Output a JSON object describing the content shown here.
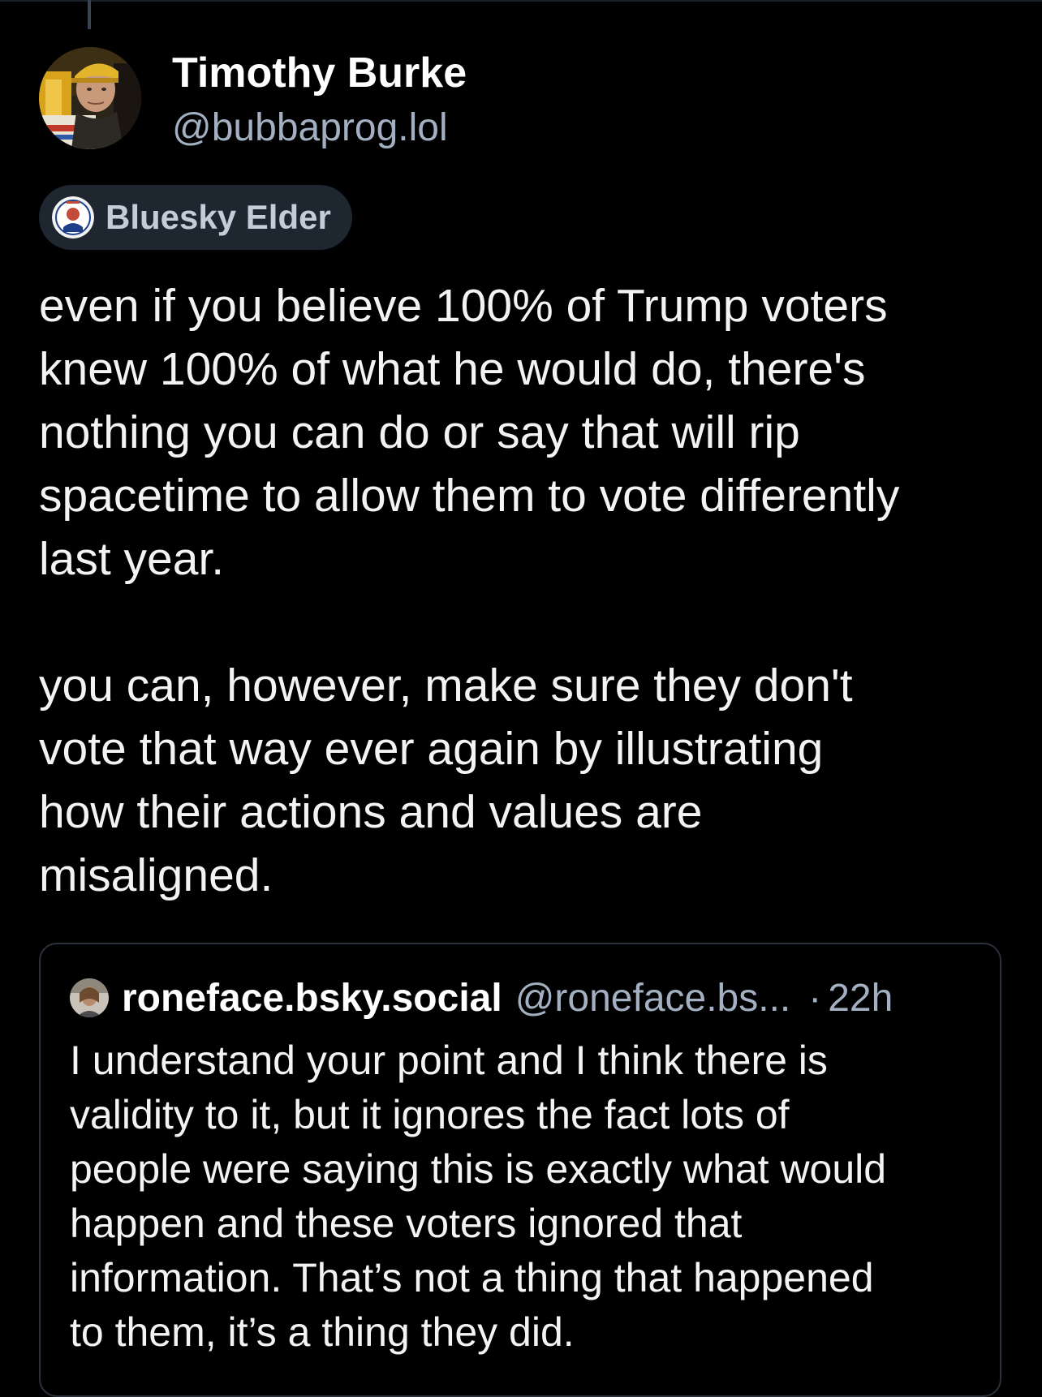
{
  "post": {
    "author": {
      "display_name": "Timothy Burke",
      "handle": "@bubbaprog.lol",
      "avatar_icon": "user-avatar"
    },
    "badge": {
      "label": "Bluesky Elder",
      "icon": "elder-badge-icon"
    },
    "paragraphs": [
      "even if you believe 100% of Trump voters\nknew 100% of what he would do, there's\nnothing you can do or say that will rip\nspacetime to allow them to vote differently\nlast year.",
      "you can, however, make sure they don't\nvote that way ever again by illustrating\nhow their actions and values are\nmisaligned."
    ]
  },
  "quote": {
    "display_name": "roneface.bsky.social",
    "handle": "@roneface.bs...",
    "separator": "·",
    "time": "22h",
    "avatar_icon": "user-avatar",
    "text": "I understand your point and I think there is\nvalidity to it, but it ignores the fact lots of\npeople were saying this is exactly what would\nhappen and these voters ignored that\ninformation. That’s not a thing that happened\nto them, it’s a thing they did."
  },
  "colors": {
    "background": "#000000",
    "text_primary": "#f1f3f5",
    "text_secondary": "#a3b0c1",
    "badge_bg": "#1e2630",
    "card_border": "#2a313b"
  }
}
